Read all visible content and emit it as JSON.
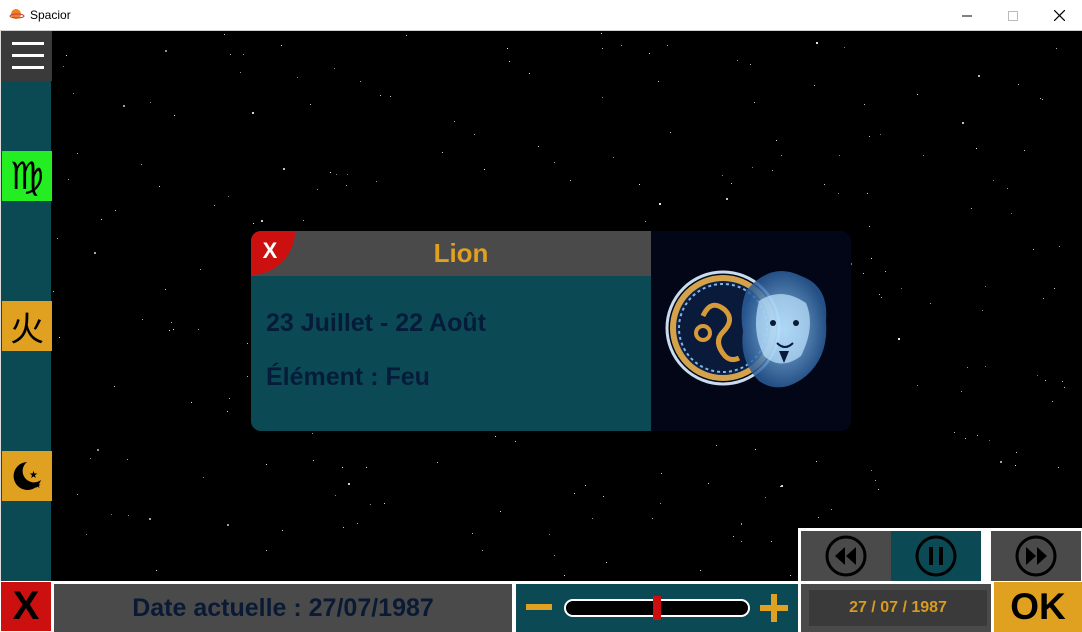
{
  "window": {
    "title": "Spacior"
  },
  "sign": {
    "name": "Lion",
    "dates": "23 Juillet - 22 Août",
    "element": "Élément : Feu",
    "close_label": "X"
  },
  "sidebar": {
    "items": [
      {
        "symbol": "♍",
        "icon": "virgo-icon",
        "color": "#22ee22"
      },
      {
        "symbol": "火",
        "icon": "fire-element-icon",
        "color": "#e0a020"
      },
      {
        "symbol": "☾",
        "icon": "moon-stars-icon",
        "color": "#e0a020"
      }
    ]
  },
  "bottom": {
    "close_label": "X",
    "current_date": "Date actuelle : 27/07/1987",
    "date_input_value": "27 / 07 / 1987",
    "ok_label": "OK",
    "speed_level": 0.5
  },
  "colors": {
    "accent": "#e0a020",
    "teal": "#0b4a54",
    "red": "#cc1010",
    "panel": "#4a4a4a"
  }
}
